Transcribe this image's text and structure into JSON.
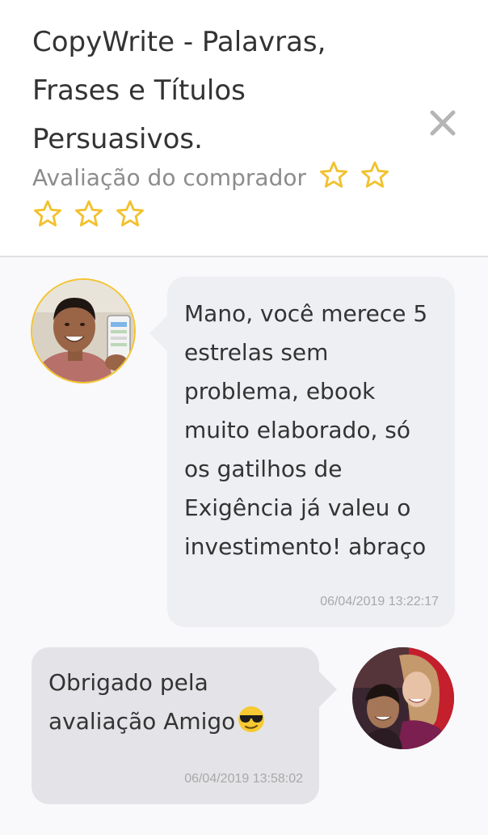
{
  "product": {
    "title": "CopyWrite - Palavras, Frases e Títulos Persuasivos."
  },
  "rating": {
    "label": "Avaliação do comprador",
    "stars_total": 5,
    "stars_value": 0,
    "star_color": "#f2c12e"
  },
  "messages": [
    {
      "author": "buyer",
      "text": "Mano, você merece 5 estrelas sem problema, ebook muito elaborado, só os gatilhos de Exigência já valeu o investimento! abraço",
      "timestamp": "06/04/2019 13:22:17"
    },
    {
      "author": "seller",
      "text": "Obrigado pela avaliação Amigo",
      "emoji": "smiling-face-with-sunglasses",
      "timestamp": "06/04/2019 13:58:02"
    }
  ],
  "colors": {
    "buyer_avatar_border": "#f4c430",
    "buyer_bubble": "#eeeff3",
    "seller_bubble": "#e4e4e8",
    "close_icon": "#b5b5b5"
  }
}
